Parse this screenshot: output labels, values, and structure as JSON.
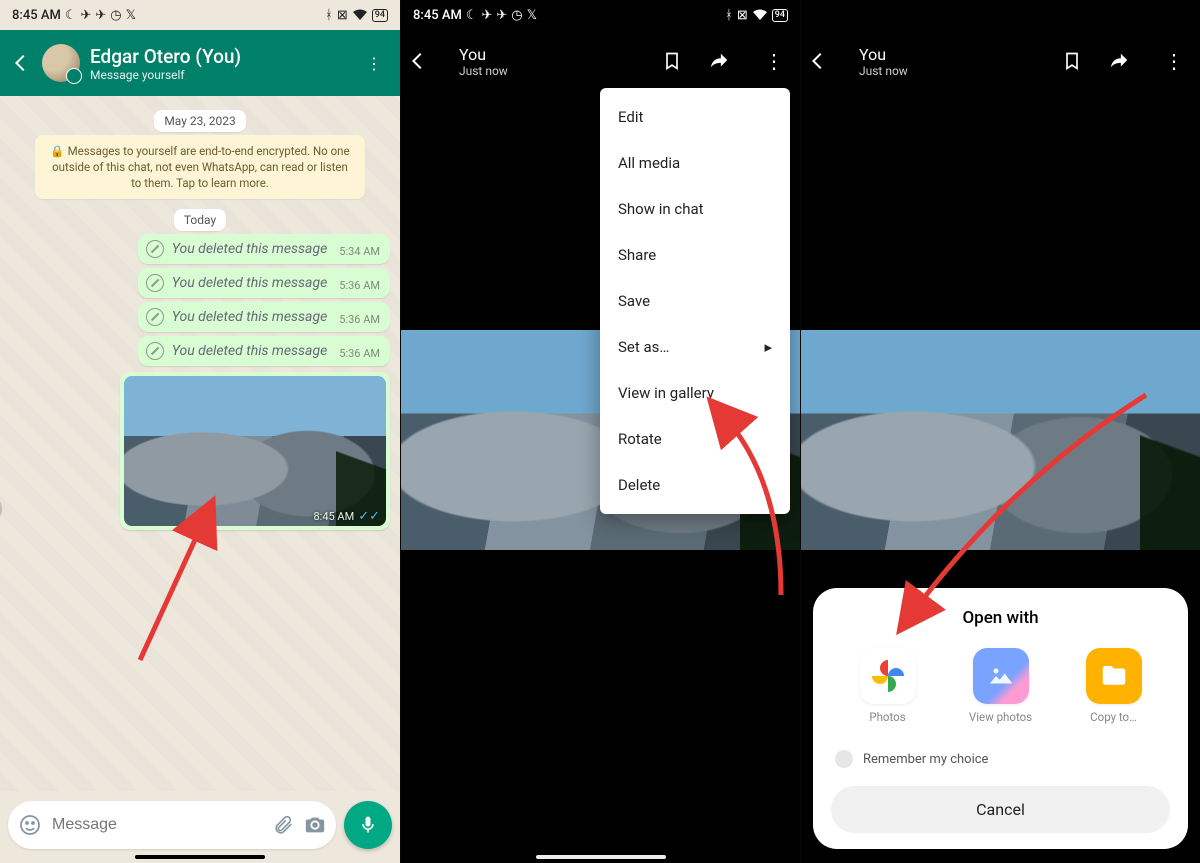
{
  "status": {
    "time": "8:45 AM",
    "battery": "94"
  },
  "p1": {
    "name": "Edgar Otero (You)",
    "subtitle": "Message yourself",
    "date1": "May 23, 2023",
    "enc": "🔒 Messages to yourself are end-to-end encrypted. No one outside of this chat, not even WhatsApp, can read or listen to them. Tap to learn more.",
    "date2": "Today",
    "deleted": [
      {
        "text": "You deleted this message",
        "time": "5:34 AM"
      },
      {
        "text": "You deleted this message",
        "time": "5:36 AM"
      },
      {
        "text": "You deleted this message",
        "time": "5:36 AM"
      },
      {
        "text": "You deleted this message",
        "time": "5:36 AM"
      }
    ],
    "imgTime": "8:45 AM",
    "placeholder": "Message"
  },
  "p2": {
    "title": "You",
    "subtitle": "Just now",
    "menu": [
      "Edit",
      "All media",
      "Show in chat",
      "Share",
      "Save",
      "Set as…",
      "View in gallery",
      "Rotate",
      "Delete"
    ]
  },
  "p3": {
    "title": "You",
    "subtitle": "Just now",
    "sheetTitle": "Open with",
    "apps": [
      {
        "label": "Photos"
      },
      {
        "label": "View photos"
      },
      {
        "label": "Copy to…"
      }
    ],
    "remember": "Remember my choice",
    "cancel": "Cancel"
  }
}
